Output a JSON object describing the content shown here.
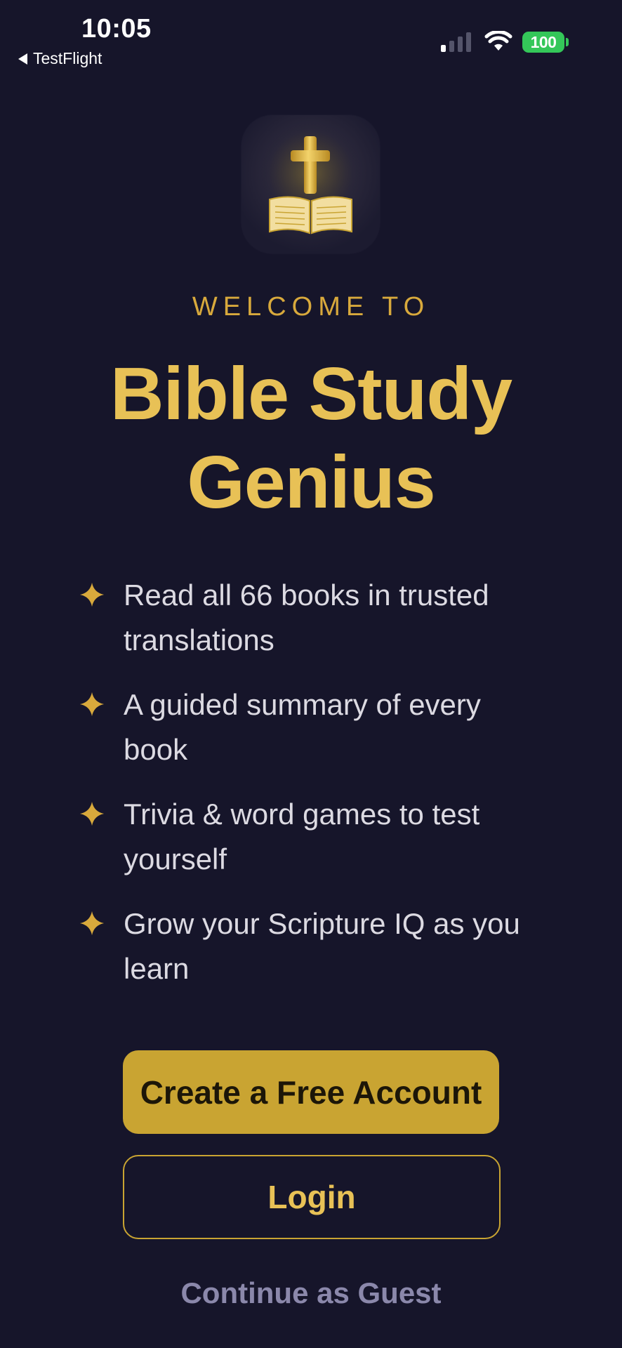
{
  "status_bar": {
    "time": "10:05",
    "back_label": "TestFlight",
    "battery": "100",
    "icons": [
      "signal-icon",
      "wifi-icon",
      "battery-icon"
    ]
  },
  "app_icon": {
    "name": "cross-and-book-icon"
  },
  "welcome": {
    "kicker": "WELCOME TO",
    "title_line1": "Bible Study",
    "title_line2": "Genius"
  },
  "features": [
    {
      "icon": "sparkle-icon",
      "text": "Read all 66 books in trusted translations"
    },
    {
      "icon": "sparkle-icon",
      "text": "A guided summary of every book"
    },
    {
      "icon": "sparkle-icon",
      "text": "Trivia & word games to test yourself"
    },
    {
      "icon": "sparkle-icon",
      "text": "Grow your Scripture IQ as you learn"
    }
  ],
  "actions": {
    "create_account": "Create a Free Account",
    "login": "Login",
    "guest": "Continue as Guest"
  },
  "colors": {
    "background": "#16152a",
    "gold": "#e8c156",
    "button_gold": "#c9a432",
    "muted": "#8b88ab",
    "battery_green": "#34c759"
  }
}
